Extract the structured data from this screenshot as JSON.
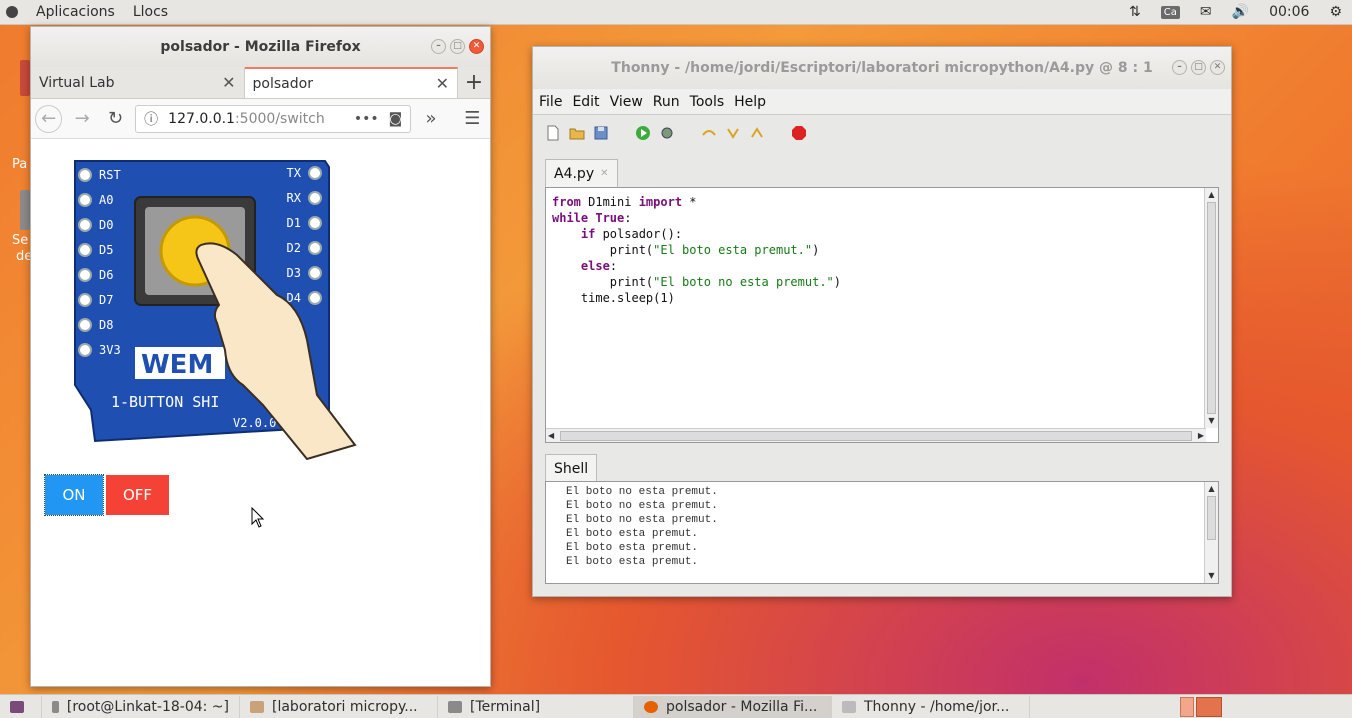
{
  "top_panel": {
    "apps_label": "Aplicacions",
    "places_label": "Llocs",
    "keyboard_layout": "Ca",
    "clock": "00:06"
  },
  "firefox": {
    "window_title": "polsador - Mozilla Firefox",
    "tabs": [
      {
        "label": "Virtual Lab"
      },
      {
        "label": "polsador"
      }
    ],
    "url_host": "127.0.0.1",
    "url_path": ":5000/switch",
    "page": {
      "board_shield_text": "1-BUTTON SHI",
      "board_brand_text": "WEM",
      "board_version_text": "V2.0.0",
      "pins_left": [
        "RST",
        "A0",
        "D0",
        "D5",
        "D6",
        "D7",
        "D8",
        "3V3"
      ],
      "pins_right": [
        "TX",
        "RX",
        "D1",
        "D2",
        "D3",
        "D4"
      ],
      "on_label": "ON",
      "off_label": "OFF"
    }
  },
  "thonny": {
    "window_title": "Thonny  -  /home/jordi/Escriptori/laboratori micropython/A4.py  @  8 : 1",
    "menu": [
      "File",
      "Edit",
      "View",
      "Run",
      "Tools",
      "Help"
    ],
    "editor_tab": "A4.py",
    "shell_tab": "Shell",
    "code": {
      "line1_a": "from",
      "line1_b": " D1mini ",
      "line1_c": "import",
      "line1_d": " *",
      "line2_a": "while",
      "line2_b": " True",
      "line2_c": ":",
      "line3_a": "    ",
      "line3_b": "if",
      "line3_c": " polsador():",
      "line4_a": "        print(",
      "line4_b": "\"El boto esta premut.\"",
      "line4_c": ")",
      "line5_a": "    ",
      "line5_b": "else",
      "line5_c": ":",
      "line6_a": "        print(",
      "line6_b": "\"El boto no esta premut.\"",
      "line6_c": ")",
      "line7": "    time.sleep(1)"
    },
    "shell_lines": [
      "El boto no esta premut.",
      "El boto no esta premut.",
      "El boto no esta premut.",
      "El boto esta premut.",
      "El boto esta premut.",
      "El boto esta premut."
    ]
  },
  "taskbar": {
    "tasks": [
      {
        "label": "[root@Linkat-18-04: ~]"
      },
      {
        "label": "[laboratori micropy..."
      },
      {
        "label": "[Terminal]"
      },
      {
        "label": "polsador - Mozilla Fi..."
      },
      {
        "label": "Thonny - /home/jor..."
      }
    ]
  },
  "desktop": {
    "dock_text_1": "Pa",
    "dock_text_2": "Se",
    "dock_text_3": "de"
  }
}
